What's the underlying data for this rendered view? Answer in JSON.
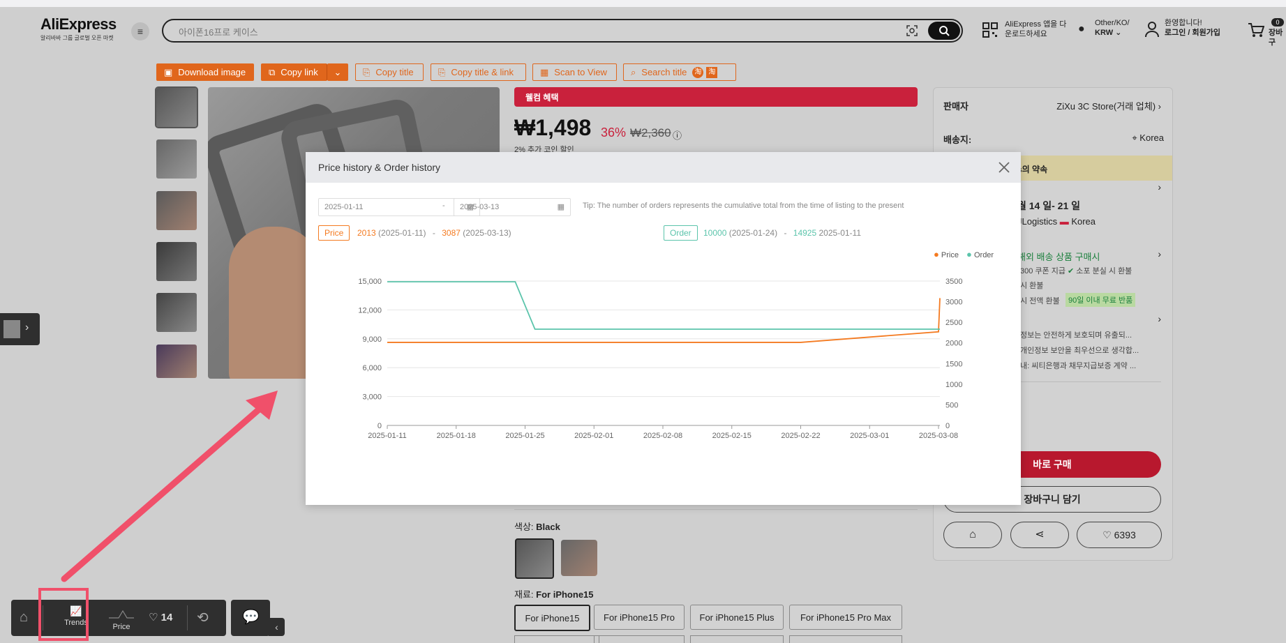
{
  "header": {
    "logo": "AliExpress",
    "logo_sub": "알리바바 그룹 글로벌 오픈 마켓",
    "search_placeholder": "아이폰16프로 케이스",
    "app_line1": "AliExpress 앱을 다",
    "app_line2": "운로드하세요",
    "locale_line1": "Other/KO/",
    "locale_line2": "KRW",
    "greet_line1": "환영합니다!",
    "greet_line2": "로그인 / 회원가입",
    "cart_badge": "0",
    "cart_label": "장바구"
  },
  "toolbar": {
    "download": "Download image",
    "copy_link": "Copy link",
    "copy_title": "Copy title",
    "copy_title_link": "Copy title & link",
    "scan": "Scan to View",
    "search_title": "Search title"
  },
  "product": {
    "welcome": "웰컴 혜택",
    "price": "₩1,498",
    "discount": "36%",
    "old_price": "₩2,360",
    "coin_note": "2% 추가 코인 할인",
    "color_label": "색상: ",
    "color_value": "Black",
    "material_label": "재료: ",
    "material_value": "For iPhone15",
    "options": [
      "For iPhone15",
      "For iPhone15 Pro",
      "For iPhone15 Plus",
      "For iPhone15 Pro Max"
    ]
  },
  "side": {
    "seller_label": "판매자",
    "seller_value": "ZiXu 3C Store(거래 업체)",
    "ship_label": "배송지:",
    "ship_value": "Korea",
    "promise": "s의 약속",
    "delivery": "월 14 일- 21 일",
    "logistics": "JLogistics",
    "logistics_dest": "Korea",
    "overseas": "해외 배송 상품 구매시",
    "coupon": "300 쿠폰 지급",
    "lost": "소포 분실 시 환불",
    "refund1": "시 환불",
    "refund2": "시 전액 환불",
    "return_badge": "90일 이내 무료 반품",
    "privacy1": "정보는 안전하게 보호되며 유출되...",
    "privacy2": "개인정보 보안을 최우선으로 생각합...",
    "privacy3": "내: 씨티은행과 채무지급보증 계약 ...",
    "buy_now": "바로 구매",
    "add_cart": "장바구니 담기",
    "likes": "6393"
  },
  "modal": {
    "title": "Price history & Order history",
    "date_from": "2025-01-11",
    "date_to": "2025-03-13",
    "date_sep": "-",
    "tip": "Tip: The number of orders represents the cumulative total from the time of listing to the present",
    "price_tag": "Price",
    "price_min": "2013",
    "price_min_date": "(2025-01-11)",
    "price_sep": "-",
    "price_max": "3087",
    "price_max_date": "(2025-03-13)",
    "order_tag": "Order",
    "order_a": "10000",
    "order_a_date": "(2025-01-24)",
    "order_sep": "-",
    "order_b": "14925",
    "order_b_date": "2025-01-11",
    "legend_price": "Price",
    "legend_order": "Order"
  },
  "bottom": {
    "trends": "Trends",
    "price": "Price",
    "likes": "14"
  },
  "colors": {
    "accent": "#e0661c",
    "price_line": "#f47a20",
    "order_line": "#5bc4ab",
    "annotation": "#f0506a"
  },
  "chart_data": {
    "type": "line",
    "x": [
      "2025-01-11",
      "2025-01-24",
      "2025-01-26",
      "2025-02-22",
      "2025-03-08",
      "2025-03-13"
    ],
    "x_ticks": [
      "2025-01-11",
      "2025-01-18",
      "2025-01-25",
      "2025-02-01",
      "2025-02-08",
      "2025-02-15",
      "2025-02-22",
      "2025-03-01",
      "2025-03-08"
    ],
    "y_left_ticks": [
      "0",
      "3,000",
      "6,000",
      "9,000",
      "12,000",
      "15,000"
    ],
    "y_right_ticks": [
      "0",
      "500",
      "1000",
      "1500",
      "2000",
      "2500",
      "3000",
      "3500"
    ],
    "ylim_left": [
      0,
      15000
    ],
    "ylim_right": [
      0,
      3500
    ],
    "series": [
      {
        "name": "Price",
        "axis": "right",
        "points": [
          [
            "2025-01-11",
            2013
          ],
          [
            "2025-02-22",
            2013
          ],
          [
            "2025-03-08",
            2270
          ],
          [
            "2025-03-13",
            3087
          ]
        ]
      },
      {
        "name": "Order",
        "axis": "left",
        "points": [
          [
            "2025-01-11",
            14925
          ],
          [
            "2025-01-24",
            14925
          ],
          [
            "2025-01-26",
            10000
          ],
          [
            "2025-03-13",
            10000
          ]
        ]
      }
    ],
    "legend": "top-right",
    "grid": true
  }
}
